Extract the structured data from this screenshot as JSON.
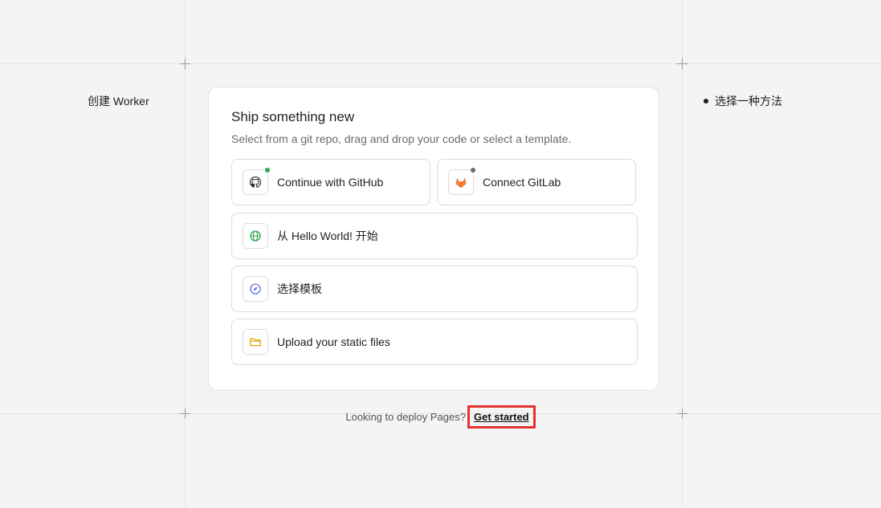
{
  "sidebar": {
    "title": "创建 Worker"
  },
  "steps": [
    {
      "label": "选择一种方法"
    }
  ],
  "card": {
    "title": "Ship something new",
    "subtitle": "Select from a git repo, drag and drop your code or select a template.",
    "options": [
      {
        "label": "Continue with GitHub",
        "icon": "github-icon",
        "status_color": "#2fa84f"
      },
      {
        "label": "Connect GitLab",
        "icon": "gitlab-icon",
        "status_color": "#6b6b6b"
      },
      {
        "label": "从 Hello World! 开始",
        "icon": "globe-icon"
      },
      {
        "label": "选择模板",
        "icon": "compass-icon"
      },
      {
        "label": "Upload your static files",
        "icon": "folder-icon"
      }
    ]
  },
  "footer": {
    "text": "Looking to deploy Pages?",
    "link": "Get started"
  },
  "colors": {
    "highlight": "#e53030",
    "globe": "#2fa84f",
    "compass": "#5b6ee1",
    "folder": "#e0a80a",
    "gitlab": "#e2672a"
  }
}
